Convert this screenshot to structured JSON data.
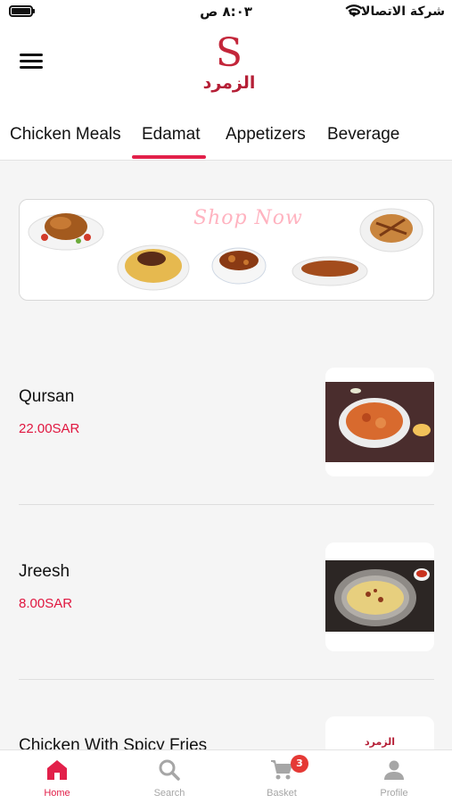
{
  "status_bar": {
    "time": "٨:٠٣ ص",
    "carrier": "شركة الاتصالات"
  },
  "header": {
    "logo_letter": "S",
    "logo_text": "الزمرد"
  },
  "tabs": [
    {
      "label": "Chicken Meals",
      "active": false
    },
    {
      "label": "Edamat",
      "active": true
    },
    {
      "label": "Appetizers",
      "active": false
    },
    {
      "label": "Beverage",
      "active": false
    }
  ],
  "banner": {
    "title": "Shop Now"
  },
  "items": [
    {
      "name": "Qursan",
      "price": "22.00SAR"
    },
    {
      "name": "Jreesh",
      "price": "8.00SAR"
    },
    {
      "name": "Chicken With Spicy Fries",
      "price": "",
      "thumb_text": "الزمرد"
    }
  ],
  "bottom_nav": {
    "items": [
      {
        "label": "Home",
        "icon": "home-icon",
        "active": true
      },
      {
        "label": "Search",
        "icon": "search-icon",
        "active": false
      },
      {
        "label": "Basket",
        "icon": "cart-icon",
        "active": false,
        "badge": "3"
      },
      {
        "label": "Profile",
        "icon": "profile-icon",
        "active": false
      }
    ]
  },
  "colors": {
    "accent": "#e2204a",
    "brand": "#c3263a",
    "price": "#e0163f"
  }
}
